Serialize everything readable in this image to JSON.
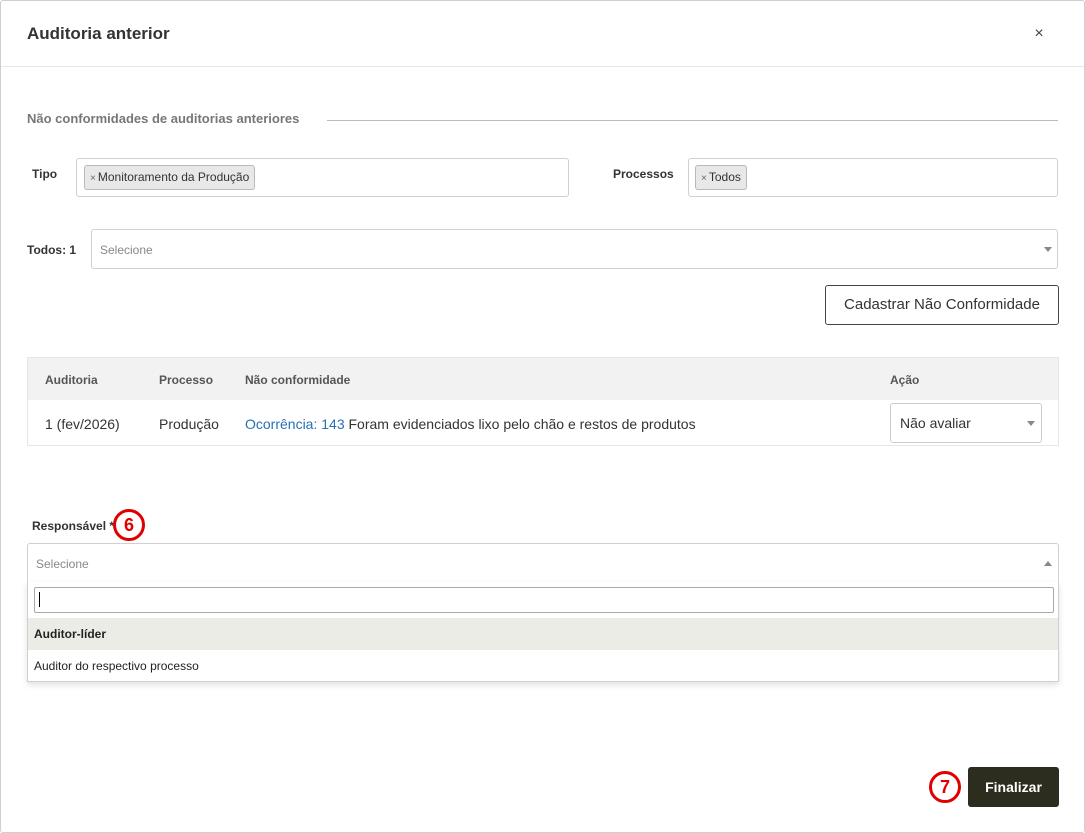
{
  "modal": {
    "title": "Auditoria anterior",
    "close_label": "×"
  },
  "section": {
    "title": "Não conformidades de auditorias anteriores"
  },
  "filters": {
    "tipo_label": "Tipo",
    "tipo_chips": [
      {
        "remove": "×",
        "label": "Monitoramento da Produção"
      }
    ],
    "processos_label": "Processos",
    "processos_chips": [
      {
        "remove": "×",
        "label": "Todos"
      }
    ],
    "todos_label": "Todos: 1",
    "todos_placeholder": "Selecione"
  },
  "actions": {
    "register_label": "Cadastrar Não Conformidade"
  },
  "table": {
    "headers": [
      "Auditoria",
      "Processo",
      "Não conformidade",
      "Ação"
    ],
    "rows": [
      {
        "auditoria": "1 (fev/2026)",
        "processo": "Produção",
        "link_text": "Ocorrência: 143",
        "description": " Foram evidenciados lixo pelo chão e restos de produtos",
        "acao": "Não avaliar"
      }
    ]
  },
  "responsavel": {
    "label": "Responsável *",
    "placeholder": "Selecione",
    "search_value": "",
    "options": [
      {
        "label": "Auditor-líder",
        "highlighted": true
      },
      {
        "label": "Auditor do respectivo processo",
        "highlighted": false
      }
    ]
  },
  "annotations": {
    "step_responsavel": "6",
    "step_finalizar": "7"
  },
  "footer": {
    "finalize_label": "Finalizar"
  },
  "colors": {
    "primary_button": "#2c2d1f",
    "link": "#2a6fb8",
    "annotation": "#e00000",
    "highlight_row": "#ecece6"
  }
}
